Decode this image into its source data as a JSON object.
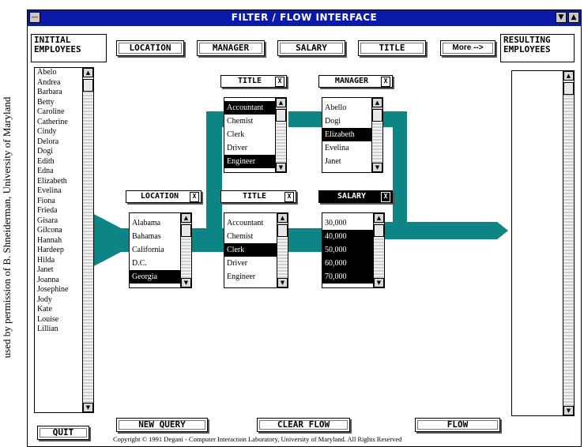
{
  "side_note": "used by permission of B. Shneiderman, University of Maryland",
  "window": {
    "title": "FILTER / FLOW INTERFACE",
    "menu_glyph": "—",
    "min_glyph": "▼",
    "max_glyph": "▲"
  },
  "initial_label": "INITIAL EMPLOYEES",
  "resulting_label": "RESULTING EMPLOYEES",
  "toolbar": {
    "location": "LOCATION",
    "manager": "MANAGER",
    "salary": "SALARY",
    "title": "TITLE",
    "more": "More -->"
  },
  "employees": [
    "Abelo",
    "Andrea",
    "Barbara",
    "Betty",
    "Caroline",
    "Catherine",
    "Cindy",
    "Delora",
    "Dogi",
    "Edith",
    "Edna",
    "Elizabeth",
    "Evelina",
    "Fiona",
    "Frieda",
    "Gisara",
    "Gilcona",
    "Hannah",
    "Hardeep",
    "Hilda",
    "Janet",
    "Joanna",
    "Josephine",
    "Jody",
    "Kate",
    "Louise",
    "Lillian"
  ],
  "filters": {
    "title_top": {
      "label": "TITLE",
      "x": "X",
      "items": [
        "Accountant",
        "Chemist",
        "Clerk",
        "Driver",
        "Engineer"
      ],
      "selected": [
        0,
        4
      ]
    },
    "manager": {
      "label": "MANAGER",
      "x": "X",
      "items": [
        "Abello",
        "Dogi",
        "Elizabeth",
        "Evelina",
        "Janet"
      ],
      "selected": [
        2
      ]
    },
    "location": {
      "label": "LOCATION",
      "x": "X",
      "items": [
        "Alabama",
        "Bahamas",
        "California",
        "D.C.",
        "Georgia"
      ],
      "selected": [
        4
      ]
    },
    "title_bottom": {
      "label": "TITLE",
      "x": "X",
      "items": [
        "Accountant",
        "Chemist",
        "Clerk",
        "Driver",
        "Engineer"
      ],
      "selected": [
        2
      ]
    },
    "salary": {
      "label": "SALARY",
      "x": "X",
      "items": [
        "30,000",
        "40,000",
        "50,000",
        "60,000",
        "70,000"
      ],
      "selected": [
        1,
        2,
        3,
        4
      ]
    }
  },
  "buttons": {
    "quit": "QUIT",
    "new_query": "NEW QUERY",
    "clear_flow": "CLEAR FLOW",
    "flow": "FLOW"
  },
  "copyright": "Copyright © 1991 Degani - Computer Interaction Laboratory, University of Maryland. All Rights Reserved",
  "colors": {
    "flow": "#0e8585",
    "titlebar": "#0b1aa8"
  }
}
